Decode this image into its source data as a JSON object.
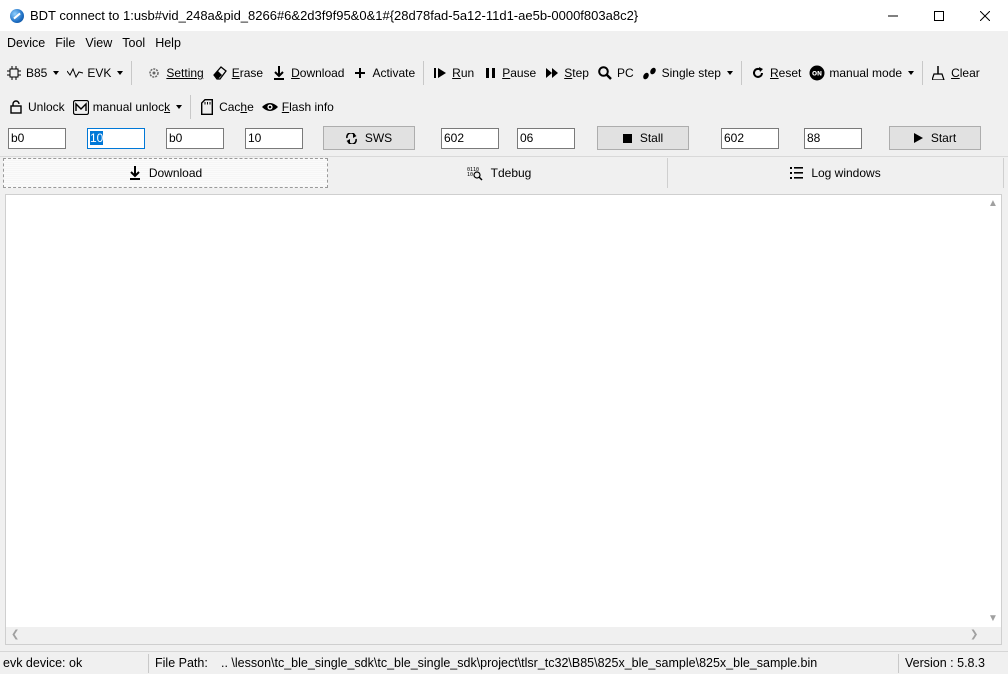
{
  "window": {
    "title": "BDT connect to 1:usb#vid_248a&pid_8266#6&2d3f9f95&0&1#{28d78fad-5a12-11d1-ae5b-0000f803a8c2}",
    "icon": "app-globe-icon"
  },
  "menu": [
    "Device",
    "File",
    "View",
    "Tool",
    "Help"
  ],
  "toolbar1": {
    "chip": "B85",
    "board": "EVK",
    "setting": "Setting",
    "erase": "Erase",
    "download": "Download",
    "activate": "Activate",
    "run": "Run",
    "pause": "Pause",
    "step": "Step",
    "pc": "PC",
    "single_step": "Single step",
    "reset": "Reset",
    "mode": "manual mode",
    "clear": "Clear"
  },
  "toolbar2": {
    "unlock": "Unlock",
    "manual_unlock": "manual unlock",
    "cache": "Cache",
    "flash_info": "Flash info"
  },
  "fields": {
    "f1": "b0",
    "f2": "10",
    "f3": "b0",
    "f4": "10",
    "sws_label": "SWS",
    "f5": "602",
    "f6": "06",
    "stall_label": "Stall",
    "f7": "602",
    "f8": "88",
    "start_label": "Start"
  },
  "tabs": [
    "Download",
    "Tdebug",
    "Log windows"
  ],
  "active_tab": "Download",
  "status": {
    "device": "evk device: ok",
    "file_path_label": "File Path:",
    "file_path": "..  \\lesson\\tc_ble_single_sdk\\tc_ble_single_sdk\\project\\tlsr_tc32\\B85\\825x_ble_sample\\825x_ble_sample.bin",
    "version": "Version : 5.8.3"
  },
  "colors": {
    "accent": "#0078d7",
    "button_face": "#e1e1e1"
  }
}
